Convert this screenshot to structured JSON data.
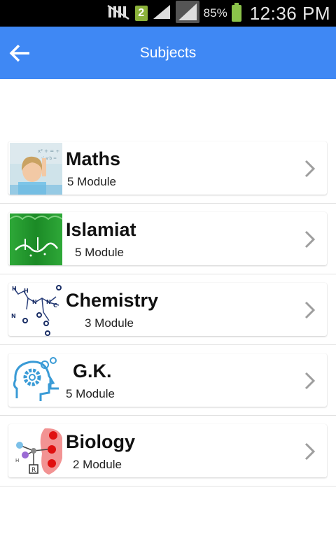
{
  "status_bar": {
    "sim_label": "2",
    "battery_percent": "85%",
    "time": "12:36 PM"
  },
  "app_bar": {
    "title": "Subjects",
    "back_icon": "arrow-left-icon"
  },
  "subjects": [
    {
      "title": "Maths",
      "modules": "5 Module",
      "thumbnail": "child-chalkboard-image"
    },
    {
      "title": "Islamiat",
      "modules": "5 Module",
      "thumbnail": "islamic-calligraphy-image"
    },
    {
      "title": "Chemistry",
      "modules": "3 Module",
      "thumbnail": "molecule-structure-image"
    },
    {
      "title": "G.K.",
      "modules": "5 Module",
      "thumbnail": "head-gears-image"
    },
    {
      "title": "Biology",
      "modules": "2 Module",
      "thumbnail": "amino-acid-diagram-image"
    }
  ],
  "colors": {
    "app_bar": "#3f88f4",
    "chevron": "#9e9e9e"
  }
}
